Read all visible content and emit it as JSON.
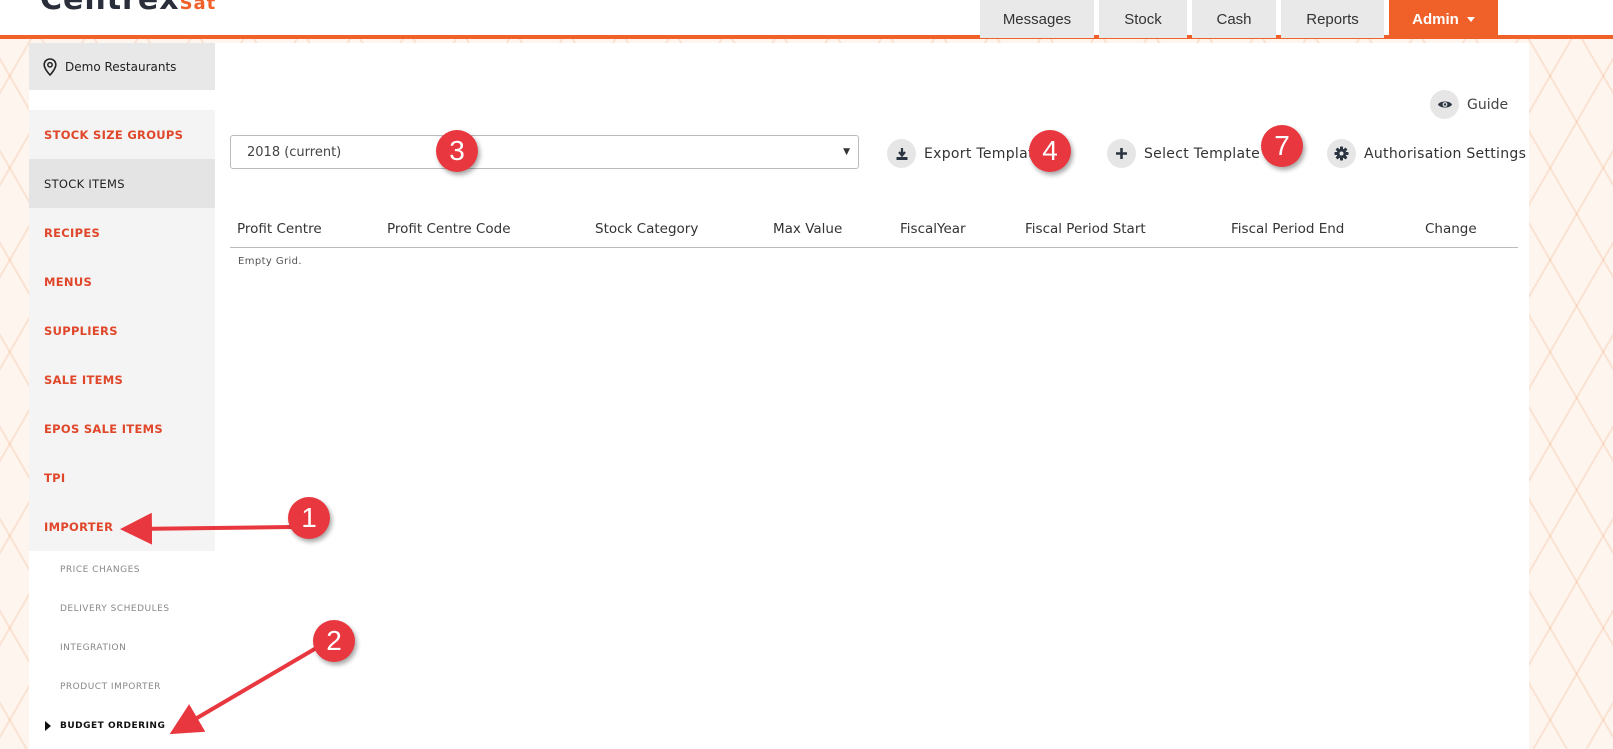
{
  "header": {
    "logo_main": "Centrex",
    "logo_accent": "Sat",
    "nav": [
      {
        "label": "Messages"
      },
      {
        "label": "Stock"
      },
      {
        "label": "Cash"
      },
      {
        "label": "Reports"
      },
      {
        "label": "Admin"
      }
    ]
  },
  "sidebar": {
    "location": "Demo Restaurants",
    "items": [
      {
        "label": "STOCK SIZE GROUPS"
      },
      {
        "label": "STOCK ITEMS"
      },
      {
        "label": "RECIPES"
      },
      {
        "label": "MENUS"
      },
      {
        "label": "SUPPLIERS"
      },
      {
        "label": "SALE ITEMS"
      },
      {
        "label": "EPOS SALE ITEMS"
      },
      {
        "label": "TPI"
      },
      {
        "label": "IMPORTER"
      }
    ],
    "sub_items": [
      {
        "label": "PRICE CHANGES"
      },
      {
        "label": "DELIVERY SCHEDULES"
      },
      {
        "label": "INTEGRATION"
      },
      {
        "label": "PRODUCT IMPORTER"
      },
      {
        "label": "BUDGET ORDERING"
      }
    ]
  },
  "toolbar": {
    "guide_label": "Guide",
    "year_select": "2018 (current)",
    "export_label": "Export Template",
    "select_label": "Select Template",
    "auth_label": "Authorisation Settings"
  },
  "grid": {
    "columns": [
      "Profit Centre",
      "Profit Centre Code",
      "Stock Category",
      "Max Value",
      "FiscalYear",
      "Fiscal Period Start",
      "Fiscal Period End",
      "Change"
    ],
    "empty_text": "Empty Grid."
  },
  "annotations": {
    "badges": [
      "1",
      "2",
      "3",
      "4",
      "7"
    ],
    "color": "#e8373e"
  },
  "colors": {
    "accent": "#f0612a",
    "menu_link": "#e0472a"
  }
}
